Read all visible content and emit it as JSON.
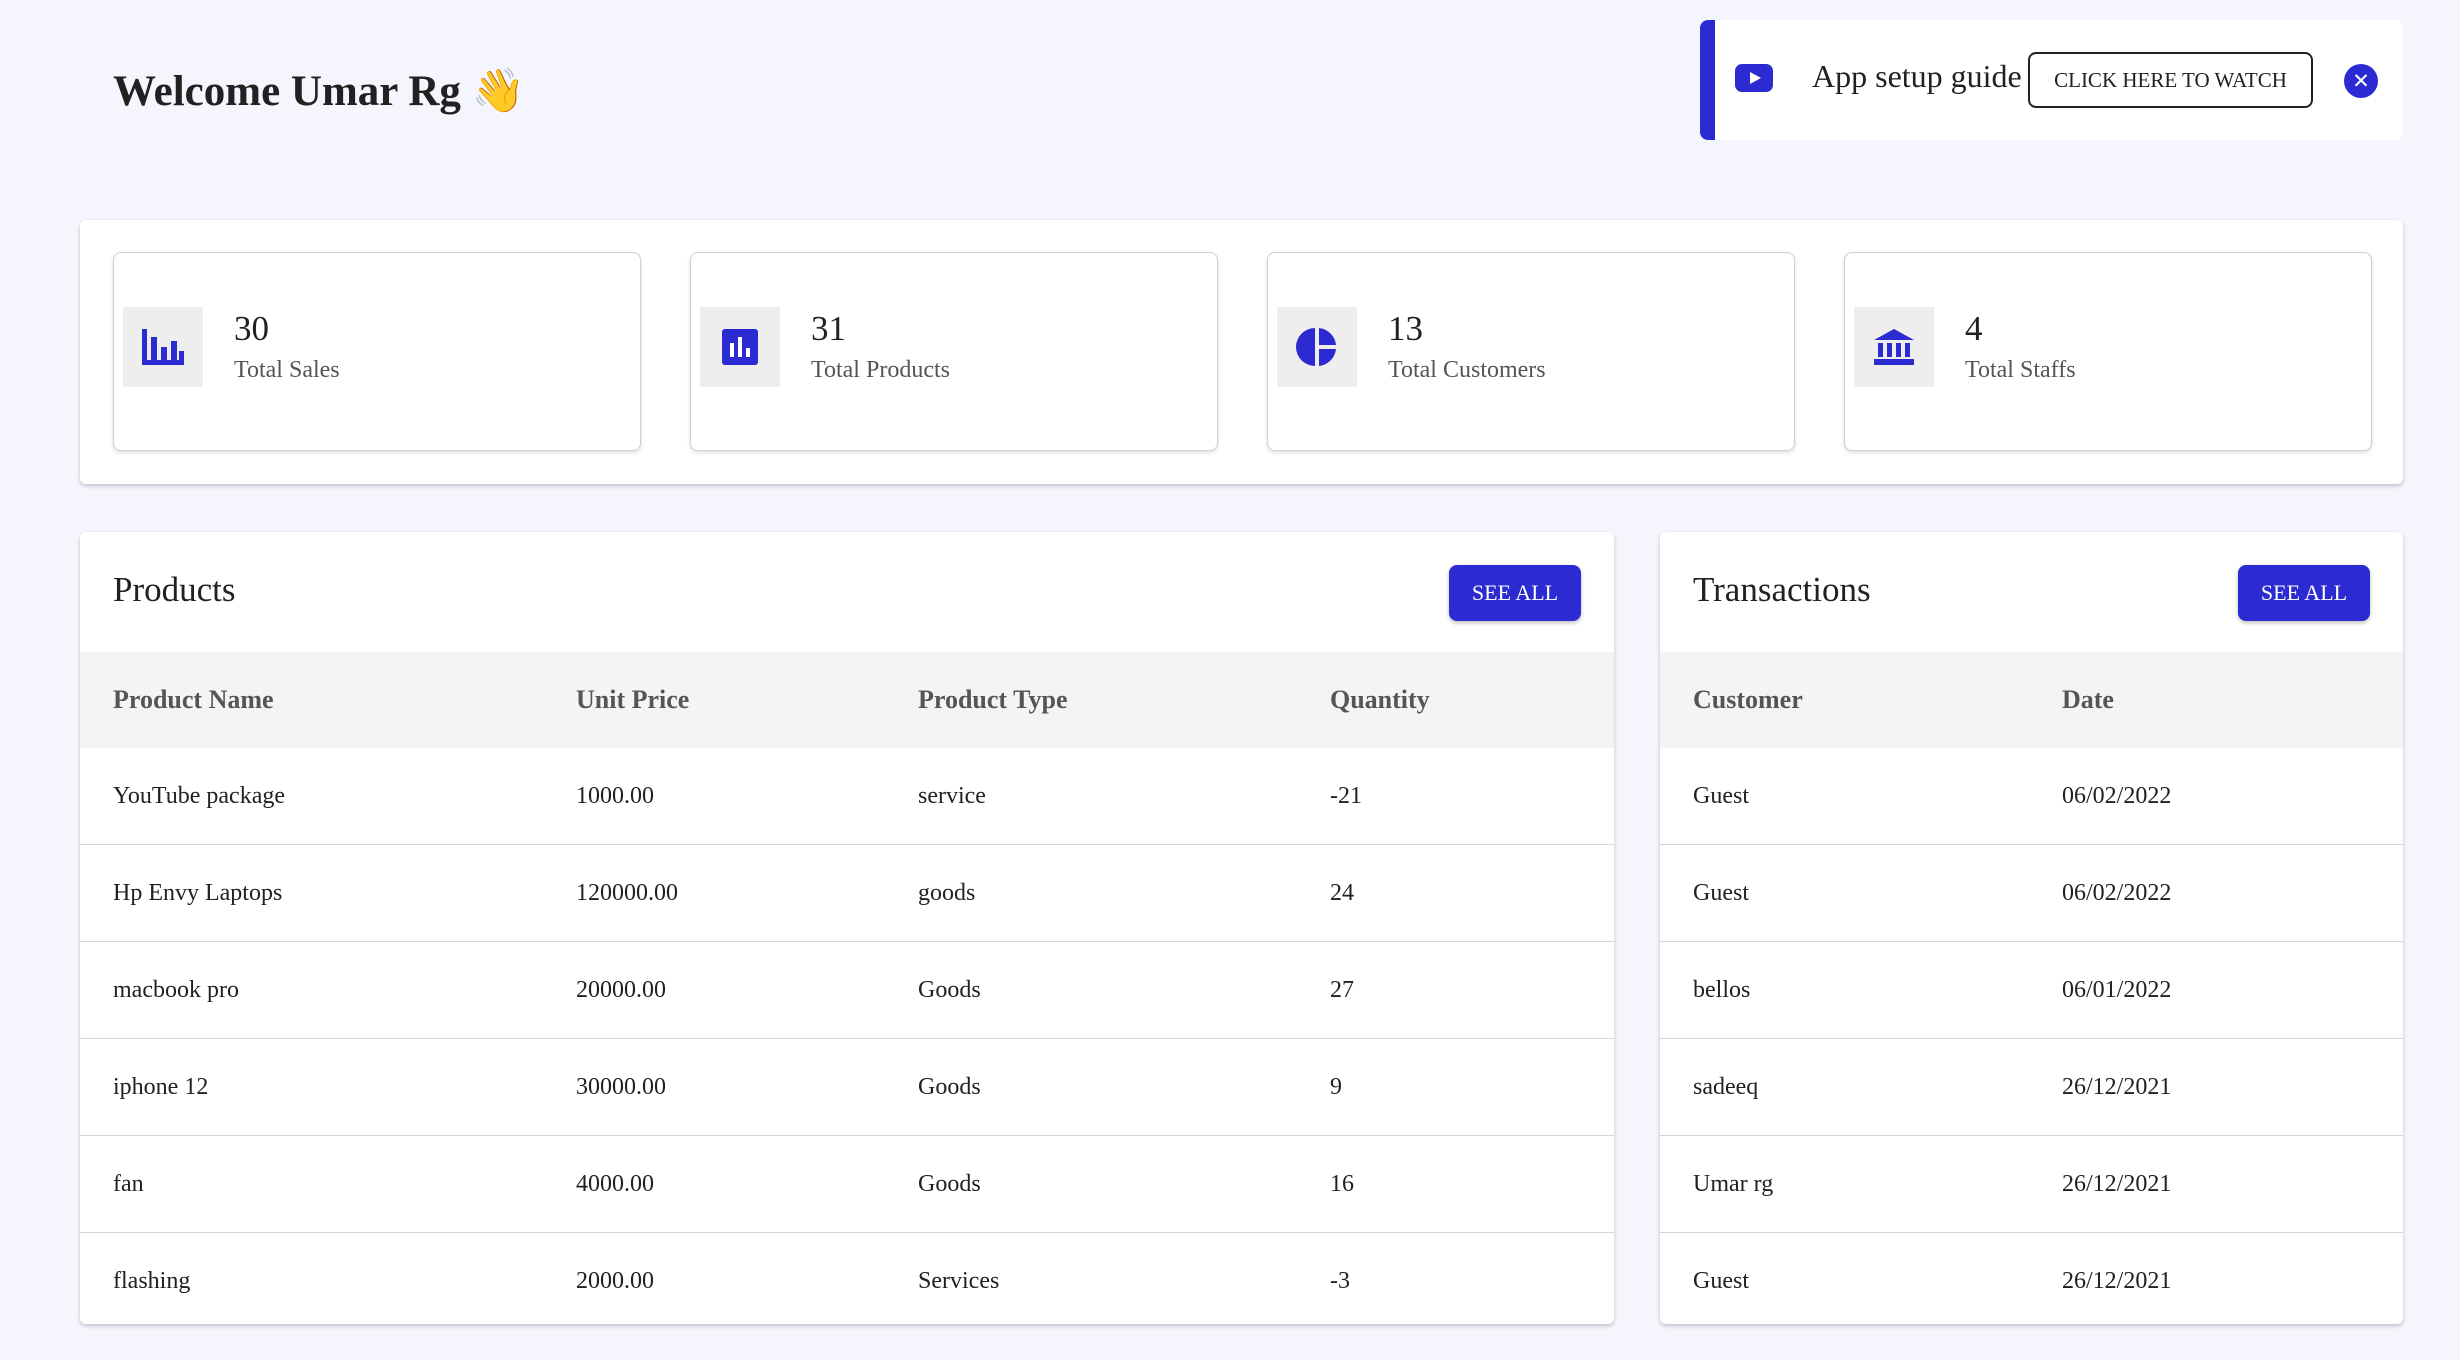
{
  "header": {
    "welcome": "Welcome Umar Rg 👋"
  },
  "guide": {
    "text": "App setup guide",
    "watch_label": "CLICK HERE TO WATCH",
    "close_glyph": "✕",
    "accent": "#2b2bd1"
  },
  "stats": [
    {
      "value": "30",
      "label": "Total Sales",
      "icon": "bar-chart-icon"
    },
    {
      "value": "31",
      "label": "Total Products",
      "icon": "chart-box-icon"
    },
    {
      "value": "13",
      "label": "Total Customers",
      "icon": "pie-chart-icon"
    },
    {
      "value": "4",
      "label": "Total Staffs",
      "icon": "bank-icon"
    }
  ],
  "products": {
    "title": "Products",
    "see_all": "SEE ALL",
    "columns": [
      "Product Name",
      "Unit Price",
      "Product Type",
      "Quantity"
    ],
    "rows": [
      [
        "YouTube package",
        "1000.00",
        "service",
        "-21"
      ],
      [
        "Hp Envy Laptops",
        "120000.00",
        "goods",
        "24"
      ],
      [
        "macbook pro",
        "20000.00",
        "Goods",
        "27"
      ],
      [
        "iphone 12",
        "30000.00",
        "Goods",
        "9"
      ],
      [
        "fan",
        "4000.00",
        "Goods",
        "16"
      ],
      [
        "flashing",
        "2000.00",
        "Services",
        "-3"
      ]
    ]
  },
  "transactions": {
    "title": "Transactions",
    "see_all": "SEE ALL",
    "columns": [
      "Customer",
      "Date"
    ],
    "rows": [
      [
        "Guest",
        "06/02/2022"
      ],
      [
        "Guest",
        "06/02/2022"
      ],
      [
        "bellos",
        "06/01/2022"
      ],
      [
        "sadeeq",
        "26/12/2021"
      ],
      [
        "Umar rg",
        "26/12/2021"
      ],
      [
        "Guest",
        "26/12/2021"
      ]
    ]
  }
}
